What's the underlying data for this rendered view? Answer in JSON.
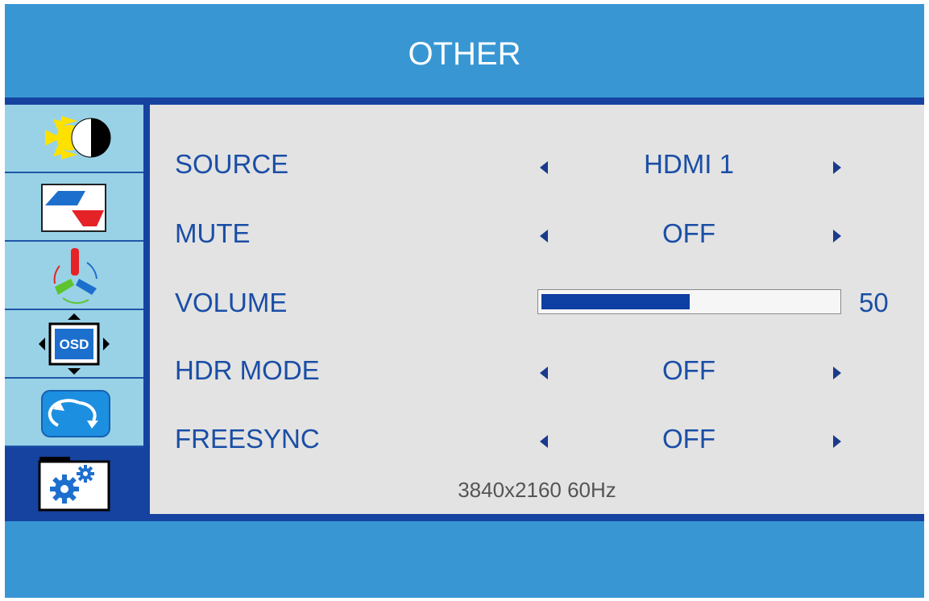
{
  "header": {
    "title": "OTHER"
  },
  "sidebar": {
    "items": [
      {
        "icon": "brightness-contrast-icon",
        "active": false
      },
      {
        "icon": "color-image-icon",
        "active": false
      },
      {
        "icon": "color-temperature-icon",
        "active": false
      },
      {
        "icon": "osd-position-icon",
        "osd_label": "OSD",
        "active": false
      },
      {
        "icon": "reset-icon",
        "active": false
      },
      {
        "icon": "settings-gears-icon",
        "active": true
      }
    ]
  },
  "menu": {
    "source": {
      "label": "SOURCE",
      "value": "HDMI 1"
    },
    "mute": {
      "label": "MUTE",
      "value": "OFF"
    },
    "volume": {
      "label": "VOLUME",
      "value": 50,
      "value_text": "50",
      "max": 100
    },
    "hdr_mode": {
      "label": "HDR MODE",
      "value": "OFF"
    },
    "freesync": {
      "label": "FREESYNC",
      "value": "OFF"
    }
  },
  "status": {
    "resolution": "3840x2160 60Hz"
  },
  "colors": {
    "background": "#3897d3",
    "accent_dark": "#1643a0",
    "sidebar": "#99d2e6",
    "panel": "#e3e3e3",
    "text": "#1a4ea6",
    "bar_fill": "#0e3fa2"
  }
}
